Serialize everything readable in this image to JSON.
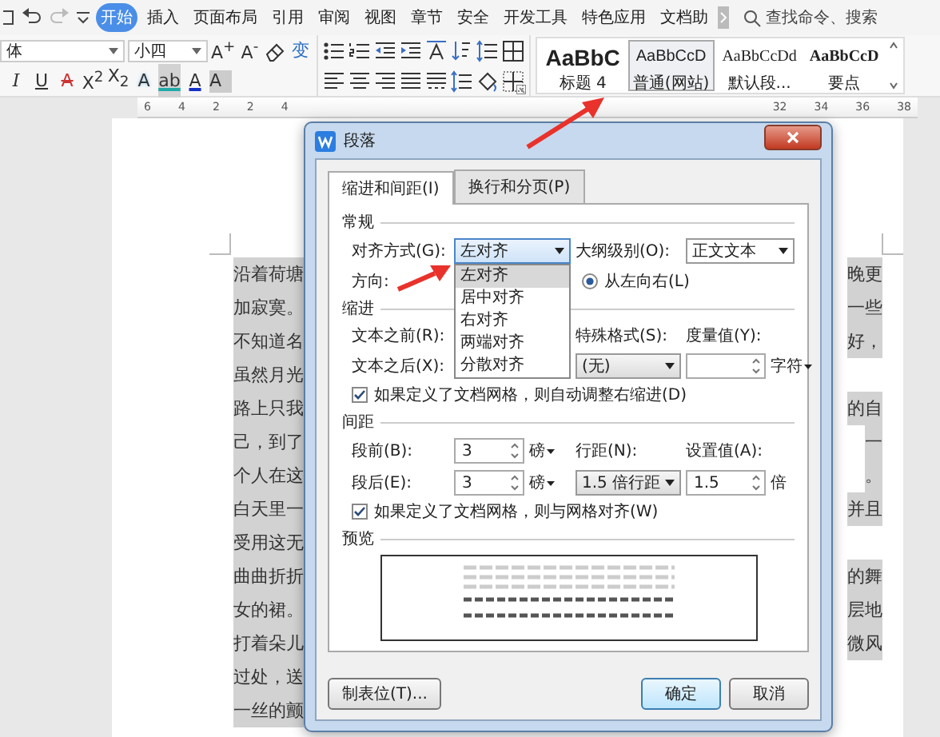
{
  "toolbar": {
    "tabs": [
      {
        "label": "开始",
        "selected": true
      },
      {
        "label": "插入",
        "selected": false
      },
      {
        "label": "页面布局",
        "selected": false
      },
      {
        "label": "引用",
        "selected": false
      },
      {
        "label": "审阅",
        "selected": false
      },
      {
        "label": "视图",
        "selected": false
      },
      {
        "label": "章节",
        "selected": false
      },
      {
        "label": "安全",
        "selected": false
      },
      {
        "label": "开发工具",
        "selected": false
      },
      {
        "label": "特色应用",
        "selected": false
      },
      {
        "label": "文档助",
        "selected": false
      }
    ],
    "search": {
      "placeholder": "查找命令、搜索"
    }
  },
  "ribbon": {
    "font_name": "体",
    "font_size": "小四",
    "font_glyphs_top": [
      "A$^{+}$",
      "A$^{-}$",
      "变"
    ],
    "font_glyphs_bottom": [
      "I",
      "U",
      "A",
      "X$^{2}$",
      "X$_{2}$",
      "A",
      "ab",
      "A",
      "A"
    ],
    "styles": [
      {
        "sample": "AaBbC",
        "label": "标题 4",
        "kind": "heading",
        "selected": false
      },
      {
        "sample": "AaBbCcD",
        "label": "普通(网站)",
        "kind": "normal",
        "selected": true
      },
      {
        "sample": "AaBbCcDd",
        "label": "默认段...",
        "kind": "serif",
        "selected": false
      },
      {
        "sample": "AaBbCcD",
        "label": "要点",
        "kind": "serif-bold",
        "selected": false
      }
    ]
  },
  "ruler": {
    "left_ticks": [
      "6",
      "4",
      "2",
      "2",
      "4"
    ],
    "right_ticks": [
      "32",
      "34",
      "36",
      "38"
    ]
  },
  "document": {
    "lines": [
      {
        "left": "沿着荷塘",
        "right": "晚更"
      },
      {
        "left": "加寂寞。",
        "right": "一些"
      },
      {
        "left": "不知道名",
        "right": "好，"
      },
      {
        "left": "虽然月光"
      },
      {
        "left": "路上只我",
        "right": "的自"
      },
      {
        "left": "己，到了",
        "right": "一"
      },
      {
        "left": "个人在这",
        "right": "。"
      },
      {
        "left": "白天里一",
        "right": "并且"
      },
      {
        "left": "受用这无"
      },
      {
        "left": "曲曲折折",
        "right": "的舞"
      },
      {
        "left": "女的裙。",
        "right": "层地"
      },
      {
        "left": "打着朵儿",
        "right": "微风"
      },
      {
        "left": "过处，送"
      },
      {
        "left": "一丝的颤"
      }
    ]
  },
  "dialog": {
    "title": "段落",
    "tabs": [
      {
        "label": "缩进和间距(I)",
        "selected": true
      },
      {
        "label": "换行和分页(P)",
        "selected": false
      }
    ],
    "general": {
      "heading": "常规",
      "alignment_label": "对齐方式(G):",
      "alignment_value": "左对齐",
      "outline_label": "大纲级别(O):",
      "outline_value": "正文文本",
      "direction_label": "方向:",
      "direction_option": {
        "label": "从左向右(L)",
        "selected": true
      },
      "alignment_options": [
        {
          "label": "左对齐",
          "selected": true
        },
        {
          "label": "居中对齐",
          "selected": false
        },
        {
          "label": "右对齐",
          "selected": false
        },
        {
          "label": "两端对齐",
          "selected": false
        },
        {
          "label": "分散对齐",
          "selected": false
        }
      ]
    },
    "indent": {
      "heading": "缩进",
      "before_label": "文本之前(R):",
      "after_label": "文本之后(X):",
      "special_label": "特殊格式(S):",
      "special_value": "(无)",
      "measure_label": "度量值(Y):",
      "measure_unit": "字符",
      "grid_checkbox": {
        "label": "如果定义了文档网格，则自动调整右缩进(D)",
        "checked": true
      }
    },
    "spacing": {
      "heading": "间距",
      "before_label": "段前(B):",
      "before_value": "3",
      "before_unit": "磅",
      "after_label": "段后(E):",
      "after_value": "3",
      "after_unit": "磅",
      "line_label": "行距(N):",
      "line_value": "1.5 倍行距",
      "at_label": "设置值(A):",
      "at_value": "1.5",
      "at_unit": "倍",
      "grid_checkbox": {
        "label": "如果定义了文档网格，则与网格对齐(W)",
        "checked": true
      }
    },
    "preview": {
      "heading": "预览"
    },
    "buttons": {
      "tab_stops": "制表位(T)...",
      "ok": "确定",
      "cancel": "取消"
    }
  }
}
